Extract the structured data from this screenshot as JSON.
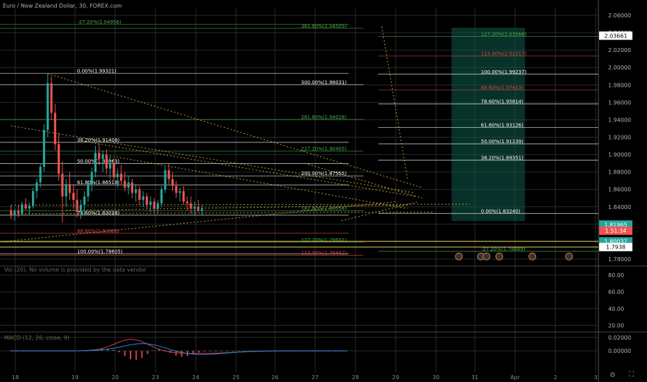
{
  "header": {
    "symbol_title": "Euro / New Zealand Dollar, 30, FOREX.com",
    "volume_note": "Vol (20), No volume is provided by the data vendor",
    "macd_note": "MACD (12, 26, close, 9)"
  },
  "colors": {
    "background": "#000000",
    "grid": "#2a2a2a",
    "candle_up": "#26a69a",
    "candle_down": "#ef5350",
    "fib_green": "#4caf50",
    "fib_red": "#e04848",
    "fib_white": "#ffffff",
    "trend_yellow": "#d8c24a",
    "target_zone": "#0f5a4a",
    "price_badge_green": "#26a69a",
    "price_badge_red": "#ef5350"
  },
  "chart_data": {
    "type": "candlestick",
    "title": "Euro / New Zealand Dollar, 30, FOREX.com",
    "x_ticks": [
      "18",
      "19",
      "20",
      "23",
      "24",
      "25",
      "26",
      "27",
      "28",
      "29",
      "30",
      "31",
      "Apr",
      "2",
      "3"
    ],
    "y_ticks": [
      "2.06000",
      "2.04000",
      "2.02000",
      "2.00000",
      "1.98000",
      "1.96000",
      "1.94000",
      "1.92000",
      "1.90000",
      "1.88000",
      "1.86000",
      "1.84000",
      "1.82000",
      "1.80000",
      "1.78000"
    ],
    "ylim": [
      1.772,
      2.068
    ],
    "x_range_days": [
      17.7,
      34
    ],
    "grid": true,
    "price_badges": [
      {
        "label": "2.03661",
        "color": "white"
      },
      {
        "label": "1.81965",
        "color": "green"
      },
      {
        "label": "1.51:34",
        "color": "red"
      },
      {
        "label": "1.80037",
        "color": "green"
      },
      {
        "label": "1.7938",
        "color": "white"
      }
    ],
    "candles_approx": [
      [
        18.0,
        1.836,
        1.842,
        1.826,
        1.83
      ],
      [
        18.1,
        1.83,
        1.838,
        1.824,
        1.835
      ],
      [
        18.2,
        1.835,
        1.842,
        1.828,
        1.832
      ],
      [
        18.3,
        1.832,
        1.846,
        1.83,
        1.843
      ],
      [
        18.4,
        1.843,
        1.85,
        1.836,
        1.838
      ],
      [
        18.5,
        1.838,
        1.845,
        1.832,
        1.841
      ],
      [
        18.6,
        1.841,
        1.862,
        1.838,
        1.858
      ],
      [
        18.7,
        1.858,
        1.872,
        1.85,
        1.868
      ],
      [
        18.8,
        1.868,
        1.89,
        1.862,
        1.886
      ],
      [
        18.9,
        1.886,
        1.935,
        1.88,
        1.928
      ],
      [
        19.0,
        1.928,
        1.993,
        1.92,
        1.982
      ],
      [
        19.1,
        1.982,
        1.99,
        1.94,
        1.948
      ],
      [
        19.2,
        1.948,
        1.958,
        1.905,
        1.912
      ],
      [
        19.3,
        1.912,
        1.925,
        1.87,
        1.878
      ],
      [
        19.4,
        1.878,
        1.892,
        1.822,
        1.852
      ],
      [
        19.5,
        1.852,
        1.872,
        1.84,
        1.866
      ],
      [
        19.6,
        1.866,
        1.88,
        1.848,
        1.856
      ],
      [
        19.7,
        1.856,
        1.866,
        1.838,
        1.848
      ],
      [
        19.8,
        1.848,
        1.86,
        1.828,
        1.834
      ],
      [
        19.9,
        1.834,
        1.848,
        1.826,
        1.842
      ],
      [
        20.0,
        1.842,
        1.858,
        1.832,
        1.852
      ],
      [
        20.1,
        1.852,
        1.87,
        1.846,
        1.866
      ],
      [
        20.2,
        1.866,
        1.885,
        1.858,
        1.88
      ],
      [
        20.3,
        1.88,
        1.91,
        1.874,
        1.902
      ],
      [
        20.4,
        1.902,
        1.912,
        1.888,
        1.895
      ],
      [
        20.5,
        1.895,
        1.905,
        1.88,
        1.9
      ],
      [
        20.6,
        1.9,
        1.906,
        1.878,
        1.884
      ],
      [
        20.7,
        1.884,
        1.898,
        1.872,
        1.89
      ],
      [
        20.8,
        1.89,
        1.896,
        1.87,
        1.874
      ],
      [
        20.9,
        1.874,
        1.884,
        1.862,
        1.878
      ],
      [
        21.0,
        1.878,
        1.888,
        1.866,
        1.87
      ],
      [
        21.1,
        1.87,
        1.88,
        1.858,
        1.862
      ],
      [
        21.2,
        1.862,
        1.876,
        1.854,
        1.868
      ],
      [
        21.3,
        1.868,
        1.872,
        1.85,
        1.856
      ],
      [
        21.4,
        1.856,
        1.866,
        1.846,
        1.86
      ],
      [
        21.5,
        1.86,
        1.864,
        1.842,
        1.848
      ],
      [
        21.6,
        1.848,
        1.858,
        1.84,
        1.852
      ],
      [
        21.7,
        1.852,
        1.856,
        1.838,
        1.842
      ],
      [
        21.8,
        1.842,
        1.852,
        1.834,
        1.846
      ],
      [
        21.9,
        1.846,
        1.85,
        1.832,
        1.838
      ],
      [
        22.0,
        1.838,
        1.848,
        1.832,
        1.844
      ],
      [
        22.1,
        1.844,
        1.864,
        1.84,
        1.86
      ],
      [
        22.2,
        1.86,
        1.886,
        1.856,
        1.882
      ],
      [
        22.3,
        1.882,
        1.89,
        1.866,
        1.872
      ],
      [
        22.4,
        1.872,
        1.88,
        1.858,
        1.864
      ],
      [
        22.5,
        1.864,
        1.87,
        1.85,
        1.856
      ],
      [
        22.6,
        1.856,
        1.862,
        1.846,
        1.858
      ],
      [
        22.7,
        1.858,
        1.864,
        1.842,
        1.846
      ],
      [
        22.8,
        1.846,
        1.852,
        1.836,
        1.844
      ],
      [
        22.9,
        1.844,
        1.852,
        1.832,
        1.838
      ],
      [
        23.0,
        1.838,
        1.846,
        1.83,
        1.84
      ],
      [
        23.1,
        1.84,
        1.848,
        1.834,
        1.836
      ],
      [
        23.2,
        1.836,
        1.842,
        1.83,
        1.838
      ]
    ],
    "fibonacci_left": [
      {
        "label": "-27.20%(2.04956)",
        "value": 2.04956,
        "color": "green"
      },
      {
        "label": "0.00%(1.99321)",
        "value": 1.99321,
        "color": "white"
      },
      {
        "label": "38.20%(1.91408)",
        "value": 1.91408,
        "color": "white"
      },
      {
        "label": "50.00%(1.88963)",
        "value": 1.88963,
        "color": "white"
      },
      {
        "label": "61.80%(1.86518)",
        "value": 1.86518,
        "color": "white"
      },
      {
        "label": "78.60%(1.83038)",
        "value": 1.83038,
        "color": "white"
      },
      {
        "label": "88.60%(1.80966)",
        "value": 1.80966,
        "color": "red"
      },
      {
        "label": "100.00%(1.78605)",
        "value": 1.78605,
        "color": "white"
      }
    ],
    "fibonacci_mid": [
      {
        "label": "361.80%(2.04505)",
        "value": 2.04505,
        "color": "green"
      },
      {
        "label": "300.00%(1.98031)",
        "value": 1.98031,
        "color": "white"
      },
      {
        "label": "261.80%(1.94028)",
        "value": 1.94028,
        "color": "green"
      },
      {
        "label": "227.20%(1.90405)",
        "value": 1.90405,
        "color": "green"
      },
      {
        "label": "200.00%(1.87555)",
        "value": 1.87555,
        "color": "white"
      },
      {
        "label": "161.80%(1.83554)",
        "value": 1.83554,
        "color": "green"
      },
      {
        "label": "127.20%(1.79931)",
        "value": 1.79931,
        "color": "green"
      },
      {
        "label": "113.00%(1.78442)",
        "value": 1.78442,
        "color": "red"
      }
    ],
    "fibonacci_right": [
      {
        "label": "127.20%(2.03568)",
        "value": 2.03568,
        "color": "green"
      },
      {
        "label": "113.00%(2.01317)",
        "value": 2.01317,
        "color": "red"
      },
      {
        "label": "100.00%(1.99237)",
        "value": 1.99237,
        "color": "white"
      },
      {
        "label": "88.60%(1.97413)",
        "value": 1.97413,
        "color": "red"
      },
      {
        "label": "78.60%(1.95814)",
        "value": 1.95814,
        "color": "white"
      },
      {
        "label": "61.80%(1.93126)",
        "value": 1.93126,
        "color": "white"
      },
      {
        "label": "50.00%(1.91239)",
        "value": 1.91239,
        "color": "white"
      },
      {
        "label": "38.20%(1.89351)",
        "value": 1.89351,
        "color": "white"
      },
      {
        "label": "0.00%(1.83240)",
        "value": 1.8324,
        "color": "white"
      },
      {
        "label": "-27.20%(1.78889)",
        "value": 1.78889,
        "color": "green"
      }
    ],
    "volume_panel": {
      "y_ticks": [
        "80.00",
        "60.00",
        "40.00",
        "20.00"
      ],
      "ylim": [
        12,
        90
      ]
    },
    "macd_panel": {
      "y_ticks": [
        "0.02000",
        "0.00000"
      ],
      "ylim": [
        -0.032,
        0.026
      ]
    }
  }
}
